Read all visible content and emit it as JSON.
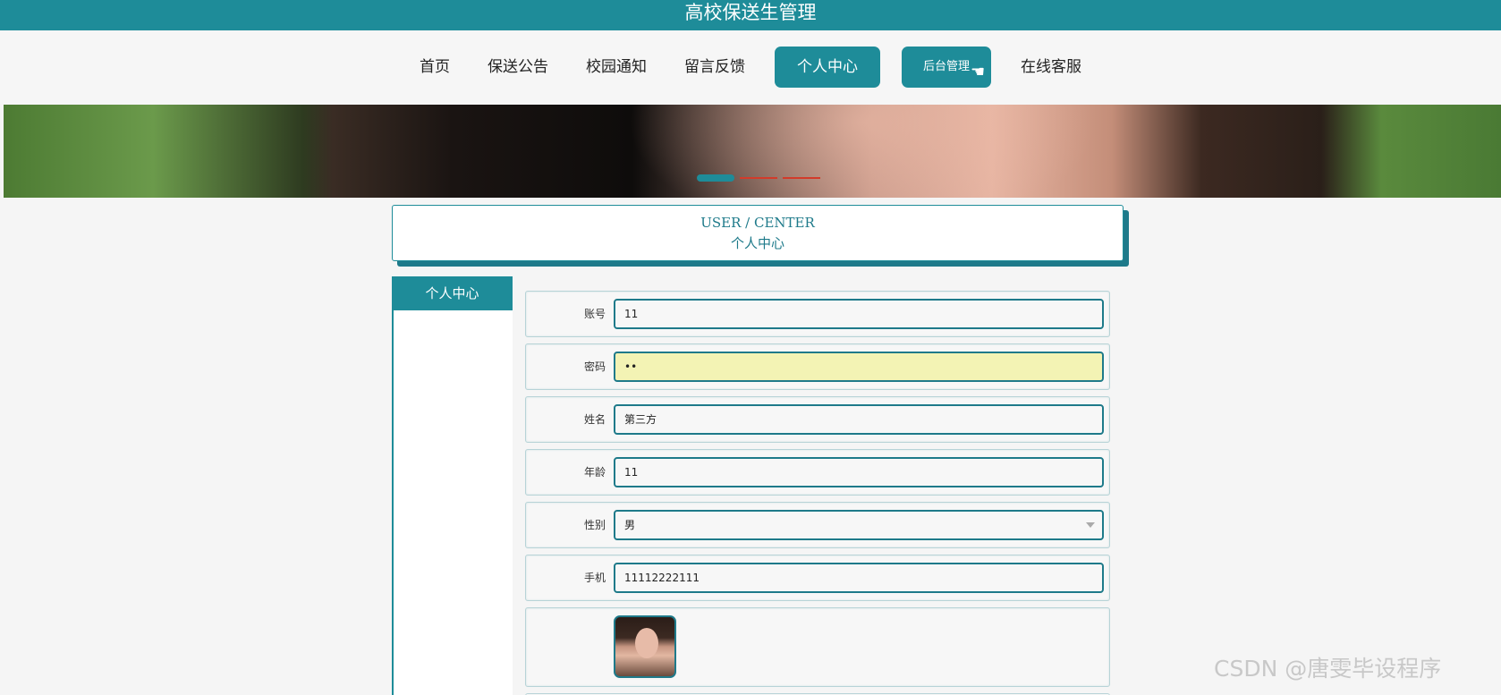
{
  "header": {
    "title": "高校保送生管理"
  },
  "nav": {
    "items": [
      {
        "label": "首页"
      },
      {
        "label": "保送公告"
      },
      {
        "label": "校园通知"
      },
      {
        "label": "留言反馈"
      },
      {
        "label": "个人中心"
      },
      {
        "label": "后台管理"
      },
      {
        "label": "在线客服"
      }
    ],
    "active_index": 4
  },
  "banner": {
    "slide_count": 3,
    "active_slide": 0
  },
  "page_title": {
    "en": "USER / CENTER",
    "cn": "个人中心"
  },
  "sidebar": {
    "items": [
      {
        "label": "个人中心"
      }
    ]
  },
  "form": {
    "fields": [
      {
        "label": "账号",
        "value": "11"
      },
      {
        "label": "密码",
        "value": "••"
      },
      {
        "label": "姓名",
        "value": "第三方"
      },
      {
        "label": "年龄",
        "value": "11"
      },
      {
        "label": "性别",
        "value": "男"
      },
      {
        "label": "手机",
        "value": "11112222111"
      }
    ]
  },
  "watermark": "CSDN @唐雯毕设程序",
  "colors": {
    "primary": "#1e8c99",
    "accent_dot": "#d23b2a",
    "autofill": "#f3f3b4"
  }
}
